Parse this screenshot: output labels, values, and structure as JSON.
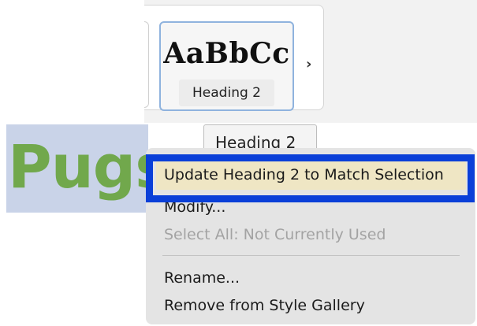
{
  "style_gallery": {
    "tile_sample_text": "AaBbCc",
    "tile_style_name": "Heading 2",
    "next_icon": "chevron-right-icon",
    "next_glyph": "›"
  },
  "tooltip": {
    "text": "Heading 2"
  },
  "document": {
    "heading_text": "Pugs"
  },
  "context_menu": {
    "items": [
      {
        "label": "Update Heading 2 to Match Selection",
        "state": "highlighted"
      },
      {
        "label": "Modify...",
        "state": "enabled"
      },
      {
        "label": "Select All: Not Currently Used",
        "state": "disabled"
      },
      {
        "label": "Rename...",
        "state": "enabled"
      },
      {
        "label": "Remove from Style Gallery",
        "state": "enabled"
      }
    ]
  },
  "colors": {
    "highlight_ring": "#0a3fd8",
    "highlighted_item_bg": "#efe6c4",
    "heading_green": "#71a84c",
    "selection_bg": "#c9d3e8"
  }
}
